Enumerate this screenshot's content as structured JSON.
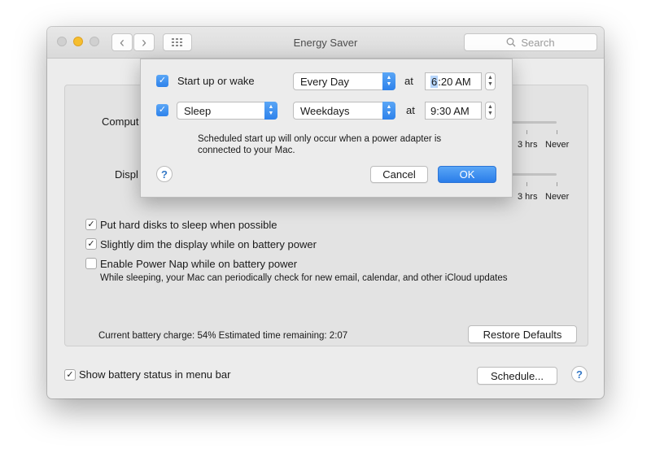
{
  "window": {
    "title": "Energy Saver",
    "search_placeholder": "Search",
    "back_glyph": "‹",
    "forward_glyph": "›",
    "grid_glyph": "⋮⋮⋮"
  },
  "sliders": {
    "computer_label": "Comput",
    "display_label": "Displ",
    "computer_ticks": [
      "3 hrs",
      "Never"
    ],
    "display_ticks": [
      "3 hrs",
      "Never"
    ]
  },
  "options": [
    {
      "label": "Put hard disks to sleep when possible",
      "checked": true
    },
    {
      "label": "Slightly dim the display while on battery power",
      "checked": true
    },
    {
      "label": "Enable Power Nap while on battery power",
      "checked": false
    }
  ],
  "power_nap_note": "While sleeping, your Mac can periodically check for new email, calendar, and other iCloud updates",
  "battery": {
    "text": "Current battery charge: 54%  Estimated time remaining: 2:07",
    "charge_percent": 54,
    "time_remaining": "2:07"
  },
  "restore_defaults_label": "Restore Defaults",
  "show_battery_label": "Show battery status in menu bar",
  "show_battery_checked": true,
  "schedule_label": "Schedule...",
  "help_glyph": "?",
  "check_glyph": "✓",
  "sheet": {
    "row1": {
      "checked": true,
      "label": "Start up or wake",
      "frequency": "Every Day",
      "at": "at",
      "time_hour": "6",
      "time_rest": ":20 AM"
    },
    "row2": {
      "checked": true,
      "action": "Sleep",
      "frequency": "Weekdays",
      "at": "at",
      "time": "9:30 AM"
    },
    "note_line1": "Scheduled start up will only occur when a power adapter is",
    "note_line2": "connected to your Mac.",
    "cancel_label": "Cancel",
    "ok_label": "OK"
  },
  "colors": {
    "accent": "#2e82eb",
    "minimize": "#f6be2e"
  }
}
